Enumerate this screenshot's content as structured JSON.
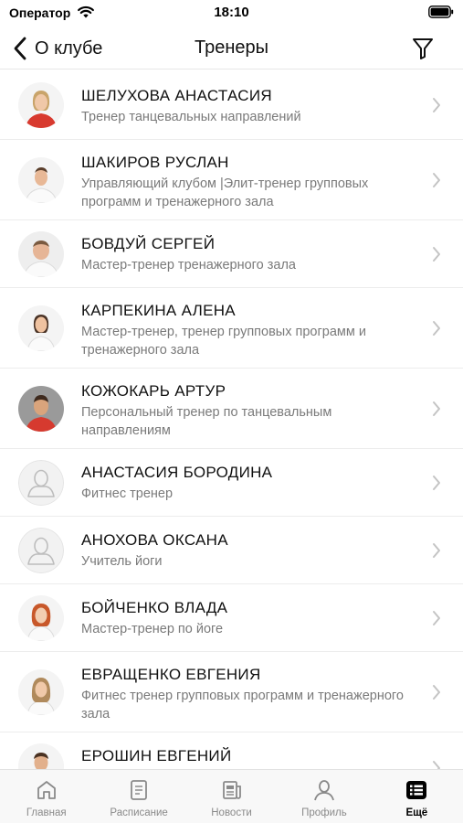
{
  "status_bar": {
    "carrier": "Оператор",
    "time": "18:10"
  },
  "nav": {
    "back_label": "О клубе",
    "title": "Тренеры"
  },
  "trainers": [
    {
      "name": "ШЕЛУХОВА АНАСТАСИЯ",
      "role": "Тренер танцевальных направлений",
      "avatar": "photo-red-shirt-woman"
    },
    {
      "name": "ШАКИРОВ РУСЛАН",
      "role": "Управляющий клубом |Элит-тренер групповых программ и тренажерного зала",
      "avatar": "photo-white-shirt-man"
    },
    {
      "name": "БОВДУЙ СЕРГЕЙ",
      "role": "Мастер-тренер тренажерного зала",
      "avatar": "photo-white-shirt-man"
    },
    {
      "name": "КАРПЕКИНА АЛЕНА",
      "role": "Мастер-тренер, тренер групповых программ и тренажерного зала",
      "avatar": "photo-white-shirt-woman"
    },
    {
      "name": "КОЖОКАРЬ АРТУР",
      "role": "Персональный тренер по танцевальным направлениям",
      "avatar": "photo-red-shirt-man-grey-bg"
    },
    {
      "name": "АНАСТАСИЯ БОРОДИНА",
      "role": "Фитнес тренер",
      "avatar": "placeholder-person-icon"
    },
    {
      "name": "АНОХОВА ОКСАНА",
      "role": "Учитель йоги",
      "avatar": "placeholder-person-icon"
    },
    {
      "name": "БОЙЧЕНКО ВЛАДА",
      "role": "Мастер-тренер по йоге",
      "avatar": "photo-redhead-woman"
    },
    {
      "name": "ЕВРАЩЕНКО ЕВГЕНИЯ",
      "role": "Фитнес тренер групповых программ и тренажерного зала",
      "avatar": "photo-white-shirt-woman"
    },
    {
      "name": "ЕРОШИН ЕВГЕНИЙ",
      "role": "",
      "avatar": "photo-red-shirt-man"
    }
  ],
  "tabs": [
    {
      "label": "Главная",
      "icon": "home-icon",
      "active": false
    },
    {
      "label": "Расписание",
      "icon": "schedule-icon",
      "active": false
    },
    {
      "label": "Новости",
      "icon": "news-icon",
      "active": false
    },
    {
      "label": "Профиль",
      "icon": "profile-icon",
      "active": false
    },
    {
      "label": "Ещё",
      "icon": "more-list-icon",
      "active": true
    }
  ],
  "colors": {
    "text_primary": "#111111",
    "text_secondary": "#7a7a7a",
    "tab_inactive": "#8a8a8a",
    "tab_active": "#000000",
    "separator": "#ececec",
    "chevron": "#c4c4c4"
  }
}
